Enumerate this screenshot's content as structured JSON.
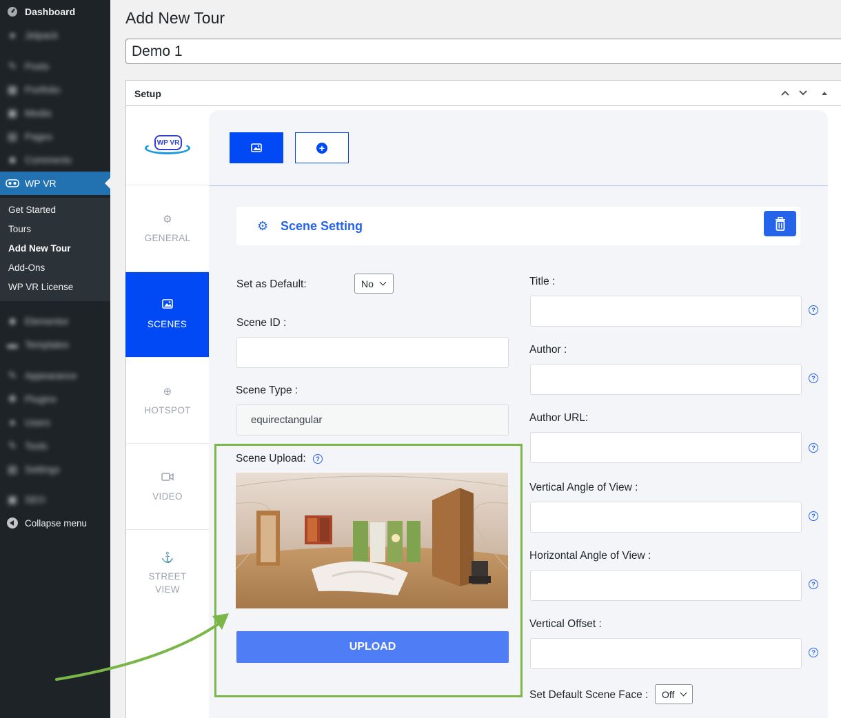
{
  "sidebar": {
    "items": [
      {
        "label": "Dashboard",
        "icon": "dashboard-icon"
      },
      {
        "label": "Jetpack",
        "icon": "jetpack-icon"
      },
      {
        "label": "Posts",
        "icon": "pin-icon"
      },
      {
        "label": "Portfolio",
        "icon": "portfolio-icon"
      },
      {
        "label": "Media",
        "icon": "media-icon"
      },
      {
        "label": "Pages",
        "icon": "pages-icon"
      },
      {
        "label": "Comments",
        "icon": "comments-icon"
      },
      {
        "label": "WP VR",
        "icon": "vr-icon"
      },
      {
        "label": "Elementor",
        "icon": "elementor-icon"
      },
      {
        "label": "Templates",
        "icon": "templates-icon"
      },
      {
        "label": "Appearance",
        "icon": "brush-icon"
      },
      {
        "label": "Plugins",
        "icon": "plugin-icon"
      },
      {
        "label": "Users",
        "icon": "users-icon"
      },
      {
        "label": "Tools",
        "icon": "wrench-icon"
      },
      {
        "label": "Settings",
        "icon": "settings-icon"
      },
      {
        "label": "SEO",
        "icon": "seo-icon"
      }
    ],
    "submenu": [
      "Get Started",
      "Tours",
      "Add New Tour",
      "Add-Ons",
      "WP VR License"
    ],
    "active_submenu": "Add New Tour",
    "collapse_label": "Collapse menu"
  },
  "page": {
    "title": "Add New Tour",
    "tour_title_value": "Demo 1"
  },
  "postbox": {
    "title": "Setup"
  },
  "wpvr": {
    "logo_text": "WP VR",
    "tabs": [
      {
        "label": "GENERAL",
        "icon": "gear-icon"
      },
      {
        "label": "SCENES",
        "icon": "image-icon"
      },
      {
        "label": "HOTSPOT",
        "icon": "crosshair-icon"
      },
      {
        "label": "VIDEO",
        "icon": "video-icon"
      },
      {
        "label": "STREET VIEW",
        "icon": "anchor-icon"
      }
    ],
    "active_tab": "SCENES",
    "scene_setting_title": "Scene Setting",
    "left_fields": {
      "set_default_label": "Set as Default:",
      "set_default_value": "No",
      "scene_id_label": "Scene ID :",
      "scene_id_value": "",
      "scene_type_label": "Scene Type :",
      "scene_type_value": "equirectangular",
      "scene_upload_label": "Scene Upload:",
      "upload_button": "UPLOAD"
    },
    "right_fields": {
      "title_label": "Title :",
      "author_label": "Author :",
      "author_url_label": "Author URL:",
      "vertical_aov_label": "Vertical Angle of View :",
      "horizontal_aov_label": "Horizontal Angle of View :",
      "vertical_offset_label": "Vertical Offset :",
      "default_face_label": "Set Default Scene Face :",
      "default_face_value": "Off"
    }
  },
  "colors": {
    "wp_sidebar": "#1d2327",
    "wp_current": "#2271b1",
    "wpvr_primary": "#0049f5",
    "annotation_green": "#7ab648"
  }
}
